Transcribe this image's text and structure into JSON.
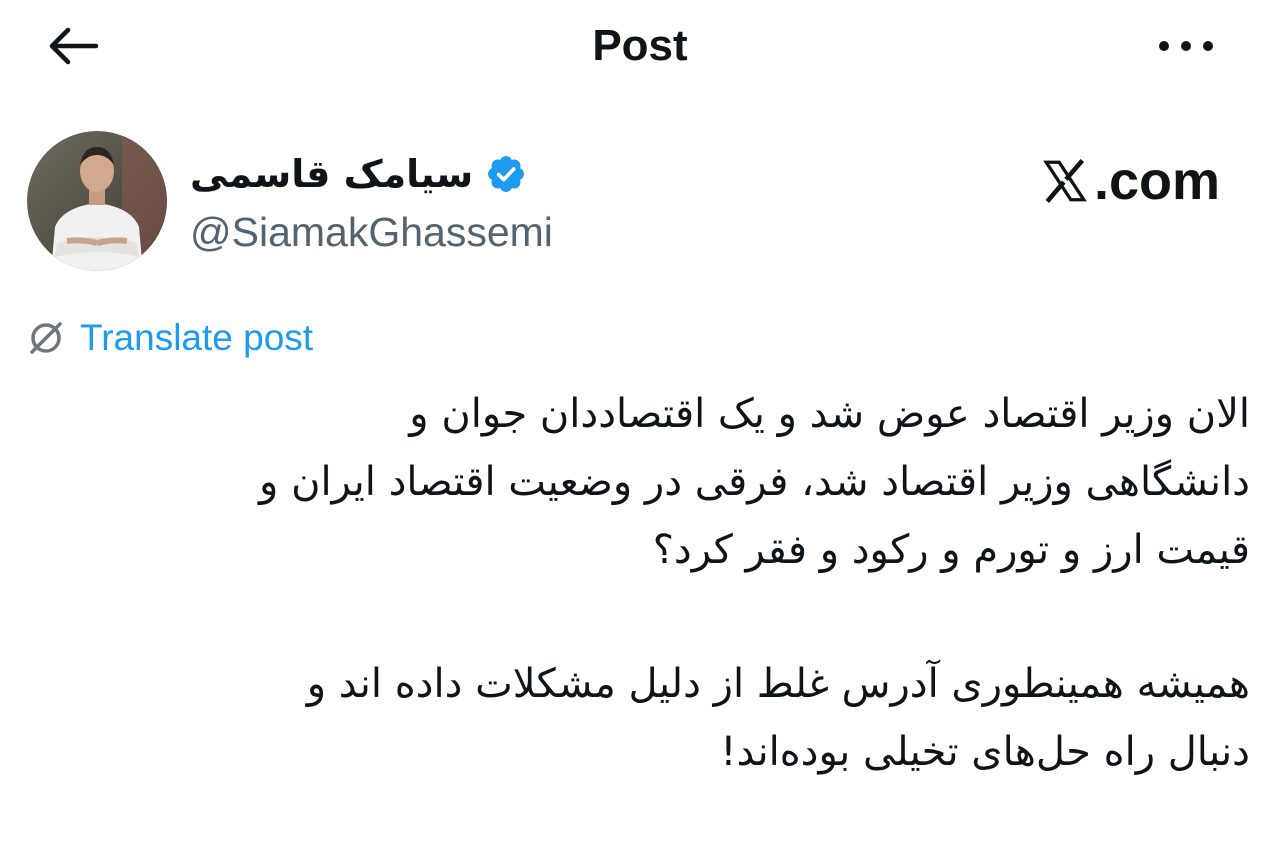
{
  "header": {
    "title": "Post",
    "back_icon": "arrow-left-icon",
    "more_icon": "ellipsis-icon"
  },
  "author": {
    "name": "سیامک قاسمی",
    "handle": "@SiamakGhassemi",
    "verified": true,
    "verified_color": "#1d9bf0"
  },
  "watermark": {
    "text": ".com"
  },
  "translate": {
    "label": "Translate post",
    "color": "#1d9bf0"
  },
  "post": {
    "paragraph1_line1": "الان وزیر اقتصاد عوض شد و یک اقتصاددان جوان و",
    "paragraph1_line2": "دانشگاهی وزیر اقتصاد شد، فرقی در وضعیت اقتصاد ایران و",
    "paragraph1_line3": "قیمت ارز و تورم و رکود و فقر کرد؟",
    "paragraph2_line1": "همیشه همینطوری آدرس غلط از دلیل مشکلات داده اند و",
    "paragraph2_line2": "دنبال راه حل‌های تخیلی بوده‌اند!"
  }
}
